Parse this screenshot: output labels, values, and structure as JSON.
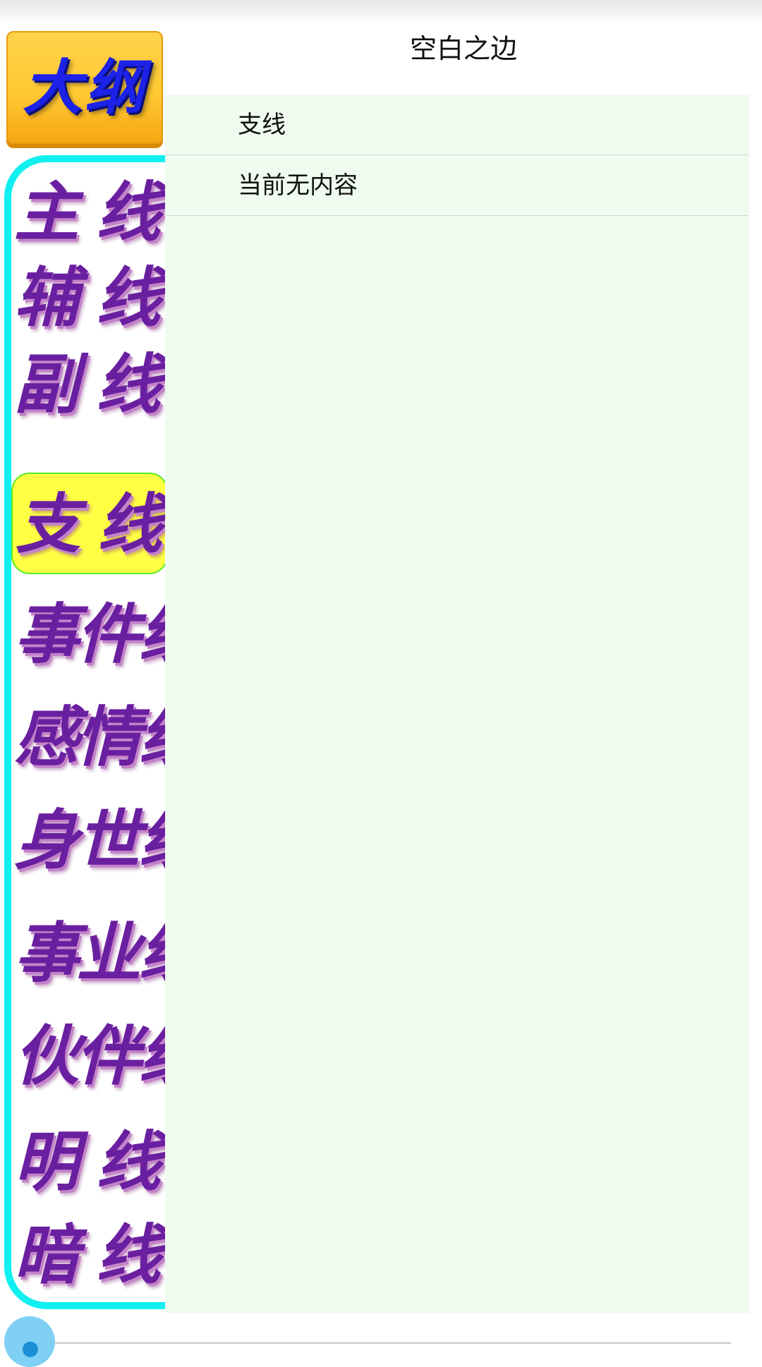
{
  "header": {
    "title": "空白之边"
  },
  "outline_button": {
    "label": "大纲"
  },
  "sidebar": {
    "items": [
      {
        "label": "主 线"
      },
      {
        "label": "辅 线"
      },
      {
        "label": "副 线"
      },
      {
        "label": "支 线",
        "selected": true
      },
      {
        "label": "事件线"
      },
      {
        "label": "感情线"
      },
      {
        "label": "身世线"
      },
      {
        "label": "事业线"
      },
      {
        "label": "伙伴线"
      },
      {
        "label": "明 线"
      },
      {
        "label": "暗 线"
      }
    ]
  },
  "content": {
    "rows": [
      {
        "text": "支线"
      },
      {
        "text": "当前无内容"
      }
    ]
  },
  "colors": {
    "sidebar_border": "#10f0f0",
    "selected_bg": "#ffff44",
    "selected_border": "#55ee22",
    "content_bg": "#f0fbf0",
    "nav_text": "#6a1fa0",
    "outline_button_bg": "#ffc933",
    "outline_button_text": "#1c22e8"
  }
}
